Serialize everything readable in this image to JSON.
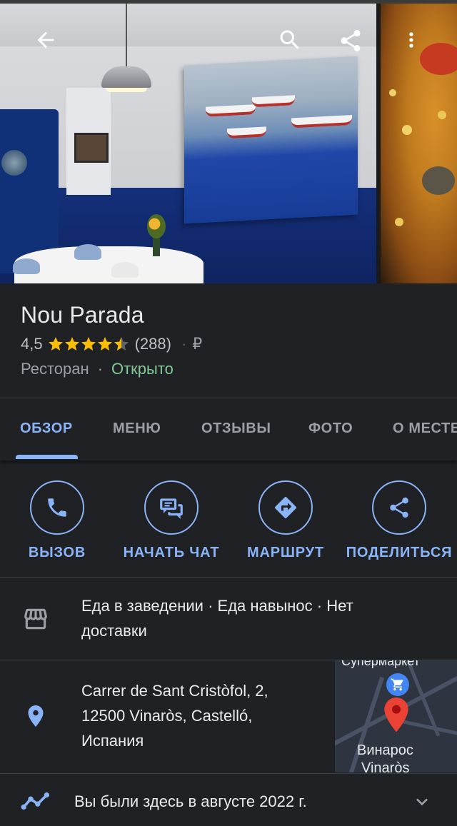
{
  "header": {
    "back_icon": "arrow-left-icon",
    "search_icon": "search-icon",
    "share_icon": "share-icon",
    "more_icon": "more-vert-icon"
  },
  "place": {
    "name": "Nou Parada",
    "rating": "4,5",
    "stars_value": 4.5,
    "reviews": "(288)",
    "separator": "·",
    "price": "₽",
    "category": "Ресторан",
    "category_separator": "·",
    "status": "Открыто"
  },
  "tabs": [
    {
      "label": "ОБЗОР",
      "active": true
    },
    {
      "label": "МЕНЮ",
      "active": false
    },
    {
      "label": "ОТЗЫВЫ",
      "active": false
    },
    {
      "label": "ФОТО",
      "active": false
    },
    {
      "label": "О МЕСТЕ",
      "active": false
    }
  ],
  "actions": [
    {
      "label": "ВЫЗОВ",
      "icon": "phone-icon"
    },
    {
      "label": "НАЧАТЬ ЧАТ",
      "icon": "chat-icon"
    },
    {
      "label": "МАРШРУТ",
      "icon": "directions-icon"
    },
    {
      "label": "ПОДЕЛИТЬСЯ",
      "icon": "share-icon"
    }
  ],
  "service": {
    "icon": "storefront-icon",
    "line1": "Еда в заведении · Еда навынос · Нет",
    "line2": "доставки"
  },
  "address": {
    "icon": "location-pin-icon",
    "line1": "Carrer de Sant Cristòfol, 2,",
    "line2": "12500 Vinaròs, Castelló,",
    "line3": "Испания",
    "map": {
      "top_label": "Супермаркет",
      "city_ru": "Винарос",
      "city_local": "Vinaròs"
    }
  },
  "visited": {
    "icon": "timeline-icon",
    "text": "Вы были здесь в августе 2022 г.",
    "expand_icon": "chevron-down-icon"
  },
  "colors": {
    "background": "#202124",
    "accent": "#8ab4f8",
    "star": "#fbbc04",
    "open": "#81c995",
    "pin": "#ea4335"
  }
}
